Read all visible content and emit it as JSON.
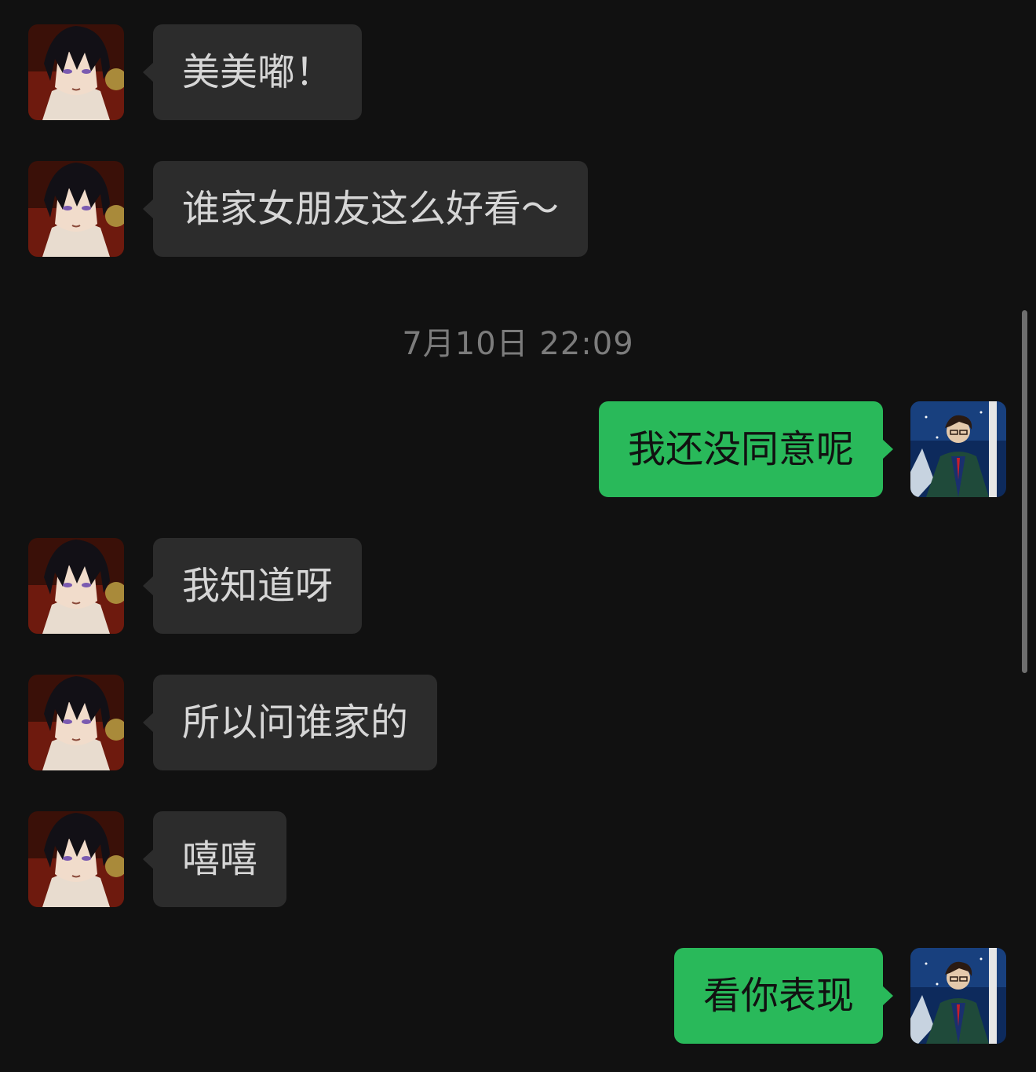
{
  "colors": {
    "background": "#111111",
    "incoming_bubble": "#2c2c2c",
    "outgoing_bubble": "#29b95a",
    "timestamp_text": "#7c7c7c"
  },
  "timestamp": "7月10日 22:09",
  "messages": [
    {
      "direction": "incoming",
      "text": "美美嘟！"
    },
    {
      "direction": "incoming",
      "text": "谁家女朋友这么好看～"
    },
    {
      "direction": "outgoing",
      "text": "我还没同意呢"
    },
    {
      "direction": "incoming",
      "text": "我知道呀"
    },
    {
      "direction": "incoming",
      "text": "所以问谁家的"
    },
    {
      "direction": "incoming",
      "text": "嘻嘻"
    },
    {
      "direction": "outgoing",
      "text": "看你表现"
    }
  ],
  "avatars": {
    "incoming_icon": "anime-boy-avatar-icon",
    "outgoing_icon": "anime-man-in-snow-avatar-icon"
  }
}
